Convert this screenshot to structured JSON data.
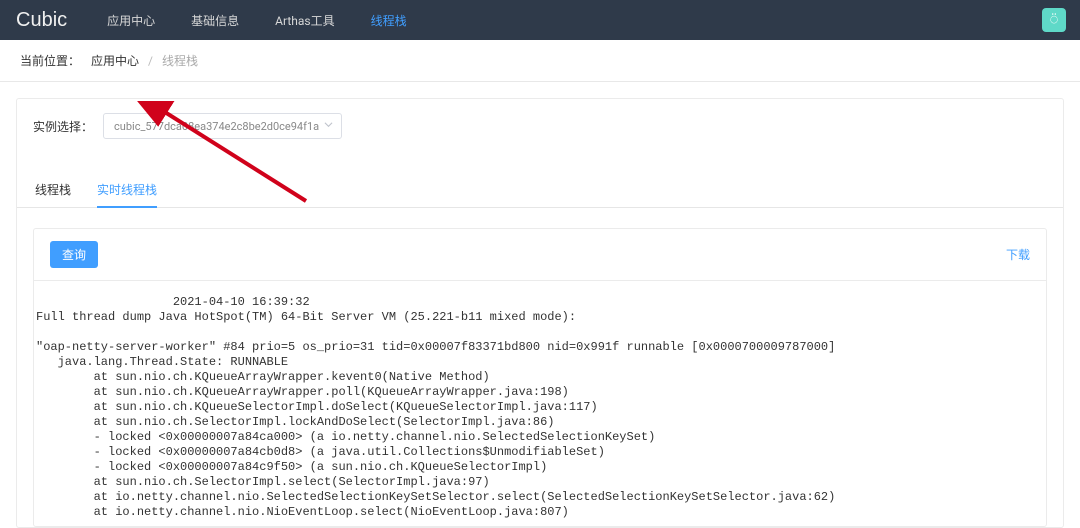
{
  "header": {
    "logo": "Cubic",
    "nav": [
      {
        "label": "应用中心",
        "active": false
      },
      {
        "label": "基础信息",
        "active": false
      },
      {
        "label": "Arthas工具",
        "active": false
      },
      {
        "label": "线程栈",
        "active": true
      }
    ],
    "avatar_glyph": "⍥"
  },
  "breadcrumb": {
    "prefix": "当前位置：",
    "link": "应用中心",
    "sep": "/",
    "current": "线程栈"
  },
  "instance": {
    "label": "实例选择：",
    "value": "cubic_577dca08ea374e2c8be2d0ce94f1a"
  },
  "tabs": [
    {
      "label": "线程栈",
      "active": false
    },
    {
      "label": "实时线程栈",
      "active": true
    }
  ],
  "buttons": {
    "query": "查询",
    "download": "下载"
  },
  "dump_text": "                   2021-04-10 16:39:32\nFull thread dump Java HotSpot(TM) 64-Bit Server VM (25.221-b11 mixed mode):\n\n\"oap-netty-server-worker\" #84 prio=5 os_prio=31 tid=0x00007f83371bd800 nid=0x991f runnable [0x0000700009787000]\n   java.lang.Thread.State: RUNNABLE\n        at sun.nio.ch.KQueueArrayWrapper.kevent0(Native Method)\n        at sun.nio.ch.KQueueArrayWrapper.poll(KQueueArrayWrapper.java:198)\n        at sun.nio.ch.KQueueSelectorImpl.doSelect(KQueueSelectorImpl.java:117)\n        at sun.nio.ch.SelectorImpl.lockAndDoSelect(SelectorImpl.java:86)\n        - locked <0x00000007a84ca000> (a io.netty.channel.nio.SelectedSelectionKeySet)\n        - locked <0x00000007a84cb0d8> (a java.util.Collections$UnmodifiableSet)\n        - locked <0x00000007a84c9f50> (a sun.nio.ch.KQueueSelectorImpl)\n        at sun.nio.ch.SelectorImpl.select(SelectorImpl.java:97)\n        at io.netty.channel.nio.SelectedSelectionKeySetSelector.select(SelectedSelectionKeySetSelector.java:62)\n        at io.netty.channel.nio.NioEventLoop.select(NioEventLoop.java:807)"
}
